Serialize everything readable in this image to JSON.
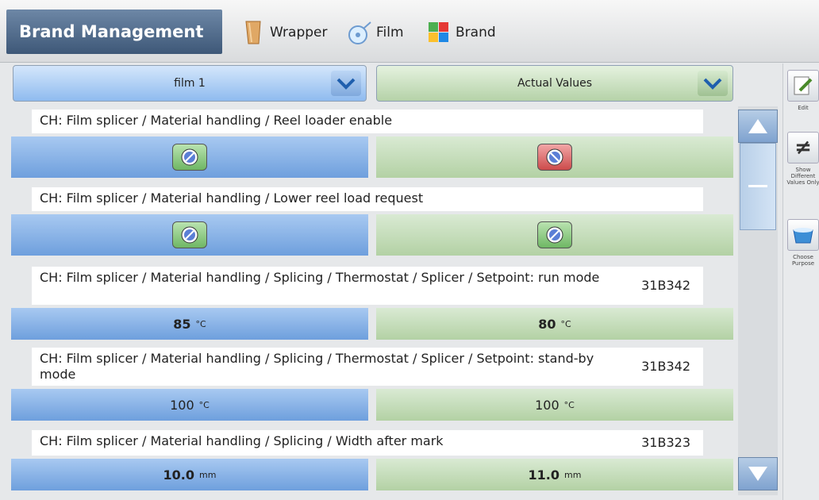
{
  "header": {
    "title": "Brand Management",
    "tabs": [
      {
        "label": "Wrapper",
        "icon": "wrapper-icon"
      },
      {
        "label": "Film",
        "icon": "film-icon"
      },
      {
        "label": "Brand",
        "icon": "brand-icon"
      }
    ]
  },
  "selectors": {
    "left": {
      "value": "film 1"
    },
    "right": {
      "value": "Actual Values"
    }
  },
  "rows": [
    {
      "label": "CH: Film splicer / Material handling / Reel loader enable",
      "code": "",
      "left": {
        "type": "icon",
        "state": "enabled"
      },
      "right": {
        "type": "icon",
        "state": "disabled"
      }
    },
    {
      "label": "CH: Film splicer / Material handling / Lower reel load request",
      "code": "",
      "left": {
        "type": "icon",
        "state": "enabled"
      },
      "right": {
        "type": "icon",
        "state": "enabled"
      }
    },
    {
      "label": "CH: Film splicer / Material handling / Splicing / Thermostat / Splicer / Setpoint: run mode",
      "code": "31B342",
      "left": {
        "value": "85",
        "unit": "°C"
      },
      "right": {
        "value": "80",
        "unit": "°C"
      }
    },
    {
      "label": "CH: Film splicer / Material handling / Splicing / Thermostat / Splicer / Setpoint: stand-by mode",
      "code": "31B342",
      "left": {
        "value": "100",
        "unit": "°C"
      },
      "right": {
        "value": "100",
        "unit": "°C"
      }
    },
    {
      "label": "CH: Film splicer / Material handling / Splicing / Width after mark",
      "code": "31B323",
      "left": {
        "value": "10.0",
        "unit": "mm"
      },
      "right": {
        "value": "11.0",
        "unit": "mm"
      }
    }
  ],
  "right_panel": [
    {
      "label": "Edit",
      "icon": "edit-icon"
    },
    {
      "label": "Show Different Values Only",
      "icon": "not-equal-icon"
    },
    {
      "label": "Choose Purpose",
      "icon": "choose-purpose-icon"
    }
  ],
  "colors": {
    "accent": "#3e5878",
    "left_column": "#8fbbef",
    "right_column": "#b5d2a8",
    "alarm": "#cc4b4b"
  }
}
